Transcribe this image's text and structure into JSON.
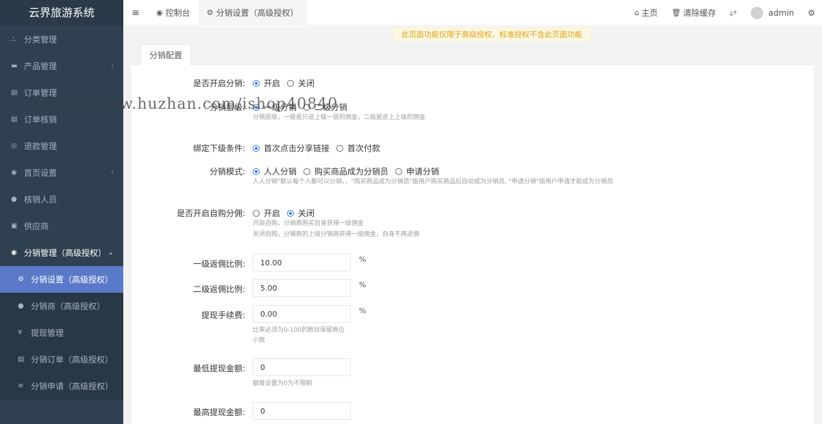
{
  "app": {
    "title": "云界旅游系统"
  },
  "sidebar": {
    "items": [
      {
        "label": "分类管理",
        "icon": "sitemap-icon"
      },
      {
        "label": "产品管理",
        "icon": "briefcase-icon",
        "caret": "‹"
      },
      {
        "label": "订单管理",
        "icon": "file-icon"
      },
      {
        "label": "订单核销",
        "icon": "file-icon"
      },
      {
        "label": "退款管理",
        "icon": "refund-icon"
      },
      {
        "label": "首页设置",
        "icon": "users-icon",
        "caret": "‹"
      },
      {
        "label": "核销人员",
        "icon": "user-icon"
      },
      {
        "label": "供应商",
        "icon": "id-card-icon"
      },
      {
        "label": "分销管理（高级授权）",
        "icon": "users-icon",
        "caret": "⌄"
      }
    ],
    "subitems": [
      {
        "label": "分销设置（高级授权）",
        "icon": "cogs-icon"
      },
      {
        "label": "分销商（高级授权）",
        "icon": "user-icon"
      },
      {
        "label": "提现管理",
        "icon": "yen-icon"
      },
      {
        "label": "分销订单（高级授权）",
        "icon": "file-icon"
      },
      {
        "label": "分销申请（高级授权）",
        "icon": "list-icon"
      }
    ]
  },
  "topbar": {
    "menu_icon": "≡",
    "tabs": [
      {
        "label": "控制台",
        "icon": "dashboard-icon"
      },
      {
        "label": "分销设置（高级授权）",
        "icon": "cogs-icon"
      }
    ],
    "home": "主页",
    "clear_cache": "清除缓存",
    "username": "admin"
  },
  "notice": "此页面功能仅限于高级授权，标准授权不含此页面功能",
  "panel": {
    "tab": "分销配置"
  },
  "form": {
    "enable": {
      "label": "是否开启分销:",
      "options": [
        "开启",
        "关闭"
      ],
      "selected": 0
    },
    "level": {
      "label": "分销层级:",
      "options": [
        "一级分销",
        "二级分销"
      ],
      "selected": 0,
      "help": "分销层级，一级是只返上级一层的佣金，二级是返上上级的佣金"
    },
    "bind": {
      "label": "绑定下级条件:",
      "options": [
        "首次点击分享链接",
        "首次付款"
      ],
      "selected": 0
    },
    "mode": {
      "label": "分销模式:",
      "options": [
        "人人分销",
        "购买商品成为分销员",
        "申请分销"
      ],
      "selected": 0,
      "help": "人人分销\"默认每个人都可以分销，，\"购买商品成为分销员\"指用户购买商品后自动成为分销员, \"申请分销\"指用户申请才能成为分销员"
    },
    "self_buy": {
      "label": "是否开启自购分佣:",
      "options": [
        "开启",
        "关闭"
      ],
      "selected": 1,
      "help1": "开启自购，分销商购买自身获得一级佣金",
      "help2": "关闭自购，分销商的上级分销商获得一级佣金，自身不再返佣"
    },
    "rate1": {
      "label": "一级返佣比例:",
      "value": "10.00",
      "unit": "%"
    },
    "rate2": {
      "label": "二级返佣比例:",
      "value": "5.00",
      "unit": "%"
    },
    "fee": {
      "label": "提现手续费:",
      "value": "0.00",
      "unit": "%",
      "help1": "比率必须为0-100的数目保留两位",
      "help2": "小数"
    },
    "min_withdraw": {
      "label": "最低提现金额:",
      "value": "0",
      "help": "额度设置为0为不限制"
    },
    "max_withdraw": {
      "label": "最高提现金额:",
      "value": "0"
    }
  },
  "watermark": "https://www.huzhan.com/ishop40840"
}
